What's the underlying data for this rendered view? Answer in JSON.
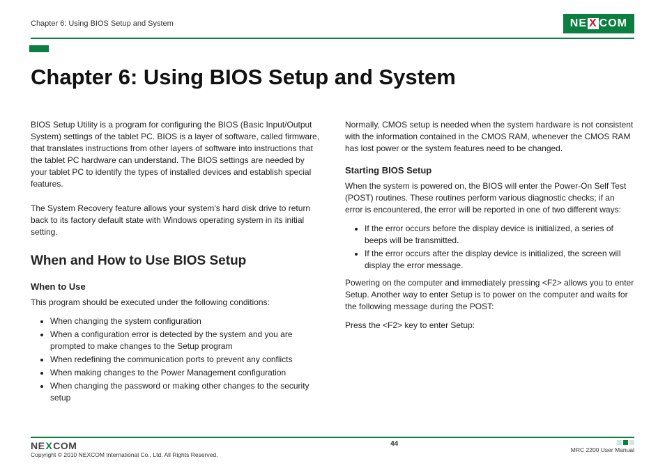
{
  "header": {
    "breadcrumb": "Chapter 6: Using BIOS Setup and System",
    "logo_pre": "NE",
    "logo_x": "X",
    "logo_post": "COM"
  },
  "title": "Chapter 6: Using BIOS Setup and System",
  "left": {
    "intro1": "BIOS Setup Utility is a program for configuring the BIOS (Basic Input/Output System) settings of the tablet PC. BIOS is a layer of software, called firmware, that translates instructions from other layers of software into instructions that the tablet PC hardware can understand. The BIOS settings are needed by your tablet PC to identify the types of installed devices and establish special features.",
    "intro2": "The System Recovery feature allows your system's hard disk drive to return back to its factory default state with Windows operating system in its initial setting.",
    "h2": "When and How to Use BIOS Setup",
    "h3": "When to Use",
    "lead": "This program should be executed under the following conditions:",
    "bullets": [
      "When changing the system configuration",
      "When a configuration error is detected by the system and you are prompted to make changes to the Setup program",
      "When redefining the communication ports to prevent any conflicts",
      "When making changes to the Power Management configuration",
      "When changing the password or making other changes to the security setup"
    ]
  },
  "right": {
    "intro": "Normally, CMOS setup is needed when the system hardware is not consistent with the information contained in the CMOS RAM, whenever the CMOS RAM has lost power or the system features need to be changed.",
    "h3": "Starting BIOS Setup",
    "post": "When the system is powered on, the BIOS will enter the Power-On Self Test (POST) routines. These routines perform various diagnostic checks; if an error is encountered, the error will be reported in one of two different ways:",
    "bullets": [
      "If the error occurs before the display device is initialized, a series of beeps will be transmitted.",
      "If the error occurs after the display device is initialized, the screen will display the error message."
    ],
    "power": "Powering on the computer and immediately pressing <F2> allows you to enter Setup. Another way to enter Setup is to power on the computer and waits for the following message during the POST:",
    "press": "Press the <F2> key to enter Setup:"
  },
  "footer": {
    "logo_pre": "NE",
    "logo_x": "X",
    "logo_post": "COM",
    "copyright": "Copyright © 2010 NEXCOM International Co., Ltd. All Rights Reserved.",
    "page": "44",
    "manual": "MRC 2200 User Manual"
  }
}
